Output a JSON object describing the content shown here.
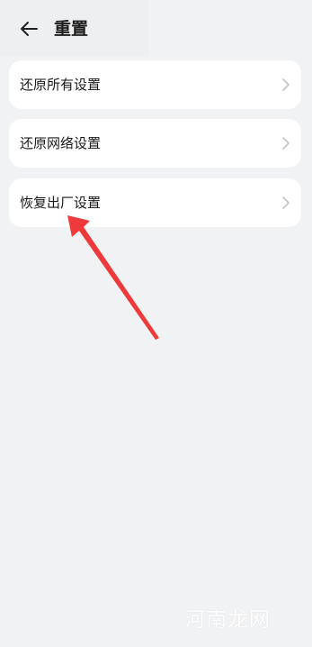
{
  "header": {
    "title": "重置",
    "back_icon": "back-arrow-icon"
  },
  "settings": {
    "items": [
      {
        "label": "还原所有设置",
        "icon": "chevron-right-icon"
      },
      {
        "label": "还原网络设置",
        "icon": "chevron-right-icon"
      },
      {
        "label": "恢复出厂设置",
        "icon": "chevron-right-icon"
      }
    ]
  },
  "annotation": {
    "color": "#ee3a3a"
  },
  "watermark": {
    "text": "河南龙网"
  }
}
